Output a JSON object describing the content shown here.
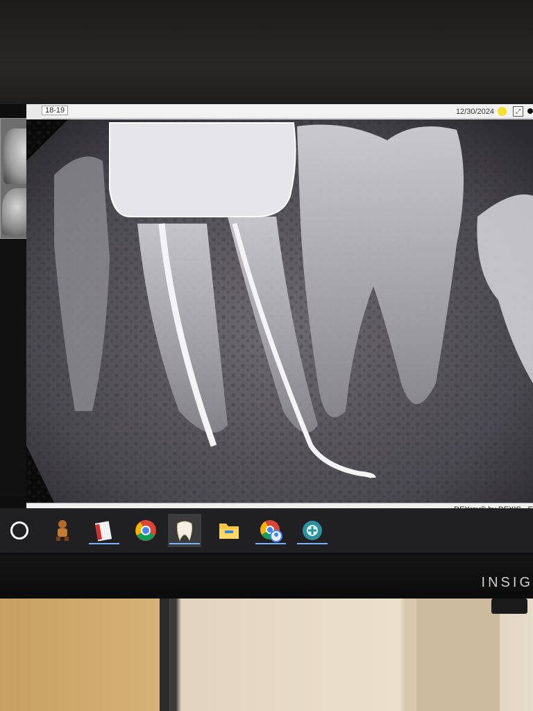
{
  "window": {
    "tooth_label": "18-19",
    "date": "12/30/2024",
    "app_credit": "DEXray® by DEXIS - E"
  },
  "monitor": {
    "brand": "INSIG"
  },
  "taskbar": {
    "items": [
      {
        "icon": "search-icon"
      },
      {
        "icon": "character-app-icon"
      },
      {
        "icon": "document-app-icon"
      },
      {
        "icon": "chrome-icon"
      },
      {
        "icon": "tooth-app-icon"
      },
      {
        "icon": "file-explorer-icon"
      },
      {
        "icon": "chrome-profile-icon"
      },
      {
        "icon": "teal-app-icon"
      }
    ]
  },
  "colors": {
    "taskbar": "#202022",
    "active_underline": "#7cb3ff",
    "sun_indicator": "#f4e02a"
  }
}
